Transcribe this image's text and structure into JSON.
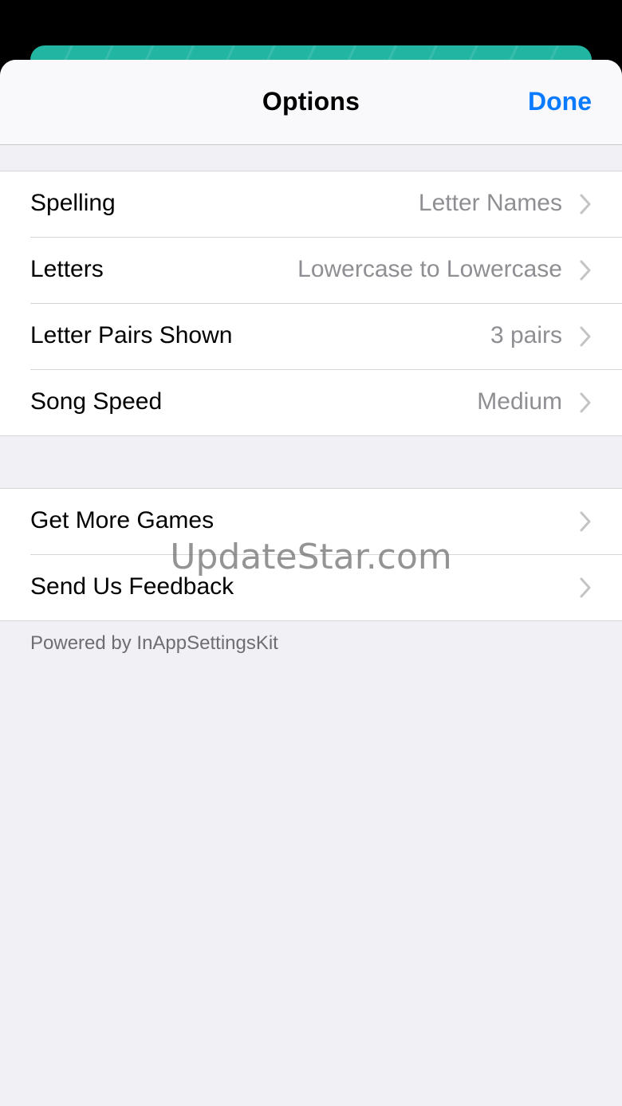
{
  "header": {
    "title": "Options",
    "done_label": "Done"
  },
  "group1": {
    "rows": [
      {
        "label": "Spelling",
        "value": "Letter Names"
      },
      {
        "label": "Letters",
        "value": "Lowercase to Lowercase"
      },
      {
        "label": "Letter Pairs Shown",
        "value": "3 pairs"
      },
      {
        "label": "Song Speed",
        "value": "Medium"
      }
    ]
  },
  "group2": {
    "rows": [
      {
        "label": "Get More Games"
      },
      {
        "label": "Send Us Feedback"
      }
    ]
  },
  "footer": {
    "text": "Powered by InAppSettingsKit"
  },
  "watermark": "UpdateStar.com",
  "icons": {
    "chevron": "chevron-right-icon"
  },
  "colors": {
    "accent": "#0a7aff",
    "background_card": "#22b5a2",
    "grouped_background": "#f0f0f5",
    "secondary_text": "#8e8e93"
  }
}
